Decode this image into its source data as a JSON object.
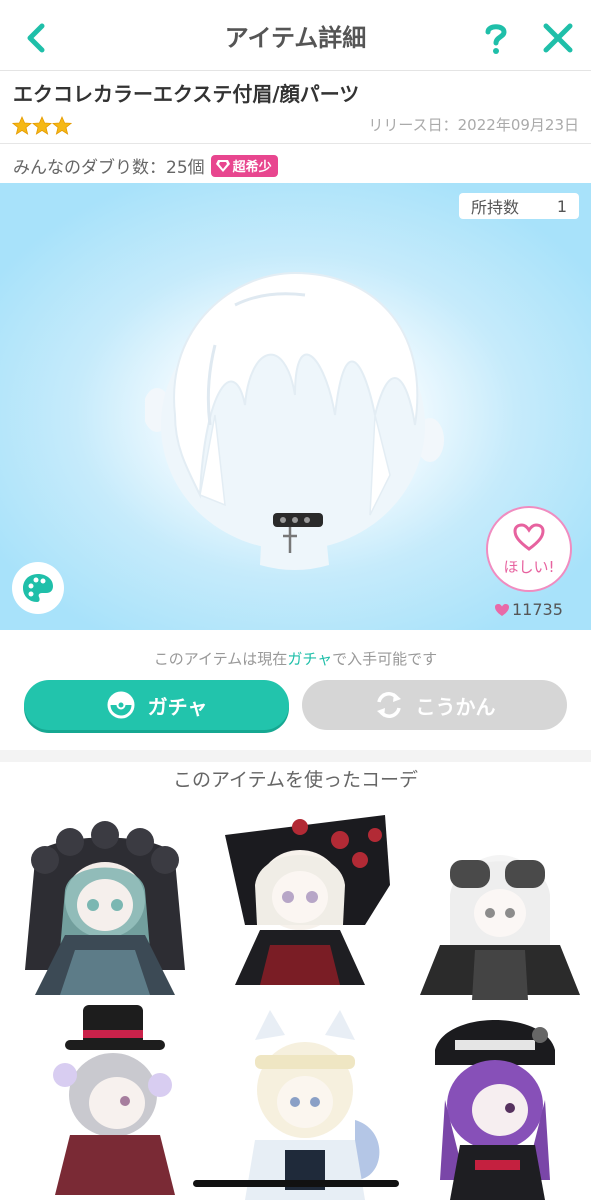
{
  "header": {
    "title": "アイテム詳細"
  },
  "item": {
    "name": "エクコレカラーエクステ付眉/顔パーツ",
    "rarity_stars": 3,
    "release_date": "リリース日：2022年09月23日",
    "duplicates": "みんなのダブり数：25個",
    "rarity_badge": "超希少"
  },
  "preview": {
    "owned_label": "所持数",
    "owned_count": "1",
    "want_label": "ほしい!",
    "like_count": "11735"
  },
  "availability": {
    "prefix": "このアイテムは現在",
    "highlight": "ガチャ",
    "suffix": "で入手可能です"
  },
  "buttons": {
    "gacha": "ガチャ",
    "trade": "こうかん"
  },
  "coordinates": {
    "title": "このアイテムを使ったコーデ"
  },
  "colors": {
    "accent": "#22c4ac",
    "pink": "#e8468f",
    "disabled": "#d6d6d6"
  }
}
